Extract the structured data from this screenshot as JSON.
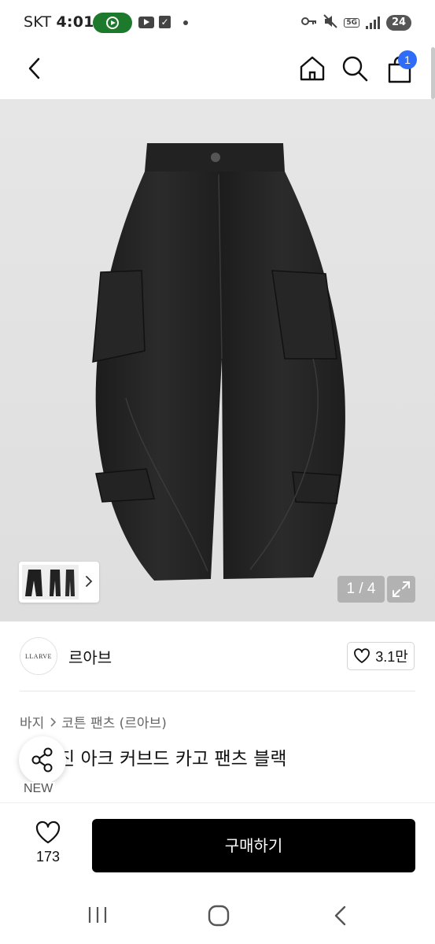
{
  "status_bar": {
    "carrier": "SKT",
    "time": "4:01",
    "network": "5G",
    "battery": "24"
  },
  "header": {
    "cart_count": "1"
  },
  "gallery": {
    "counter": "1 / 4"
  },
  "brand": {
    "logo_text": "LLARVE",
    "name": "르아브",
    "favorite_count": "3.1만"
  },
  "breadcrumb": {
    "items": [
      "바지",
      "코튼 팬츠 (르아브)"
    ]
  },
  "product": {
    "title_visible": "진 아크 커브드 카고 팬츠 블랙",
    "badge": "NEW"
  },
  "action_bar": {
    "like_count": "173",
    "buy_label": "구매하기"
  },
  "colors": {
    "accent": "#2f6df6",
    "buy_button": "#000000",
    "status_pill": "#1d7a2c"
  }
}
